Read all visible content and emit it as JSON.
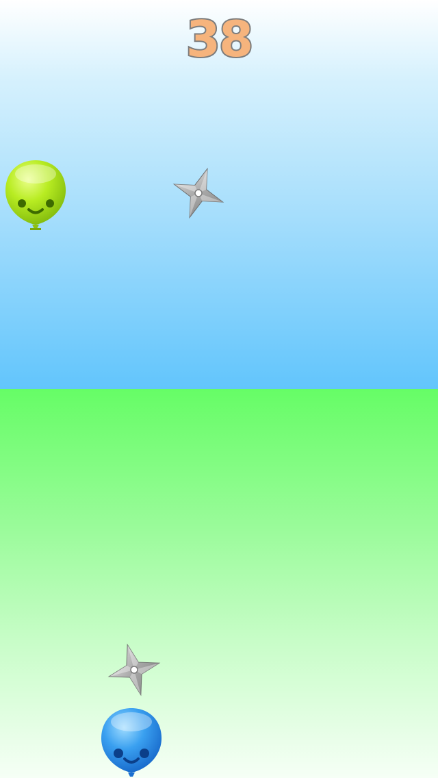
{
  "hud": {
    "score": "38"
  },
  "colors": {
    "sky_top": "#ffffff",
    "sky_bottom": "#62c5fc",
    "ground_top": "#66fd66",
    "ground_bottom": "#f6fff6",
    "score_fill": "#f6b47d",
    "score_outline": "#7d7d7d",
    "green_balloon": "#a8e21a",
    "blue_balloon": "#2a8fe6",
    "shuriken": "#b4b4b4"
  },
  "sprites": {
    "enemy_balloon": {
      "icon": "green-smiley-balloon-icon"
    },
    "player_balloon": {
      "icon": "blue-smiley-balloon-icon"
    },
    "shurikens": [
      {
        "icon": "shuriken-icon"
      },
      {
        "icon": "shuriken-icon"
      }
    ]
  }
}
